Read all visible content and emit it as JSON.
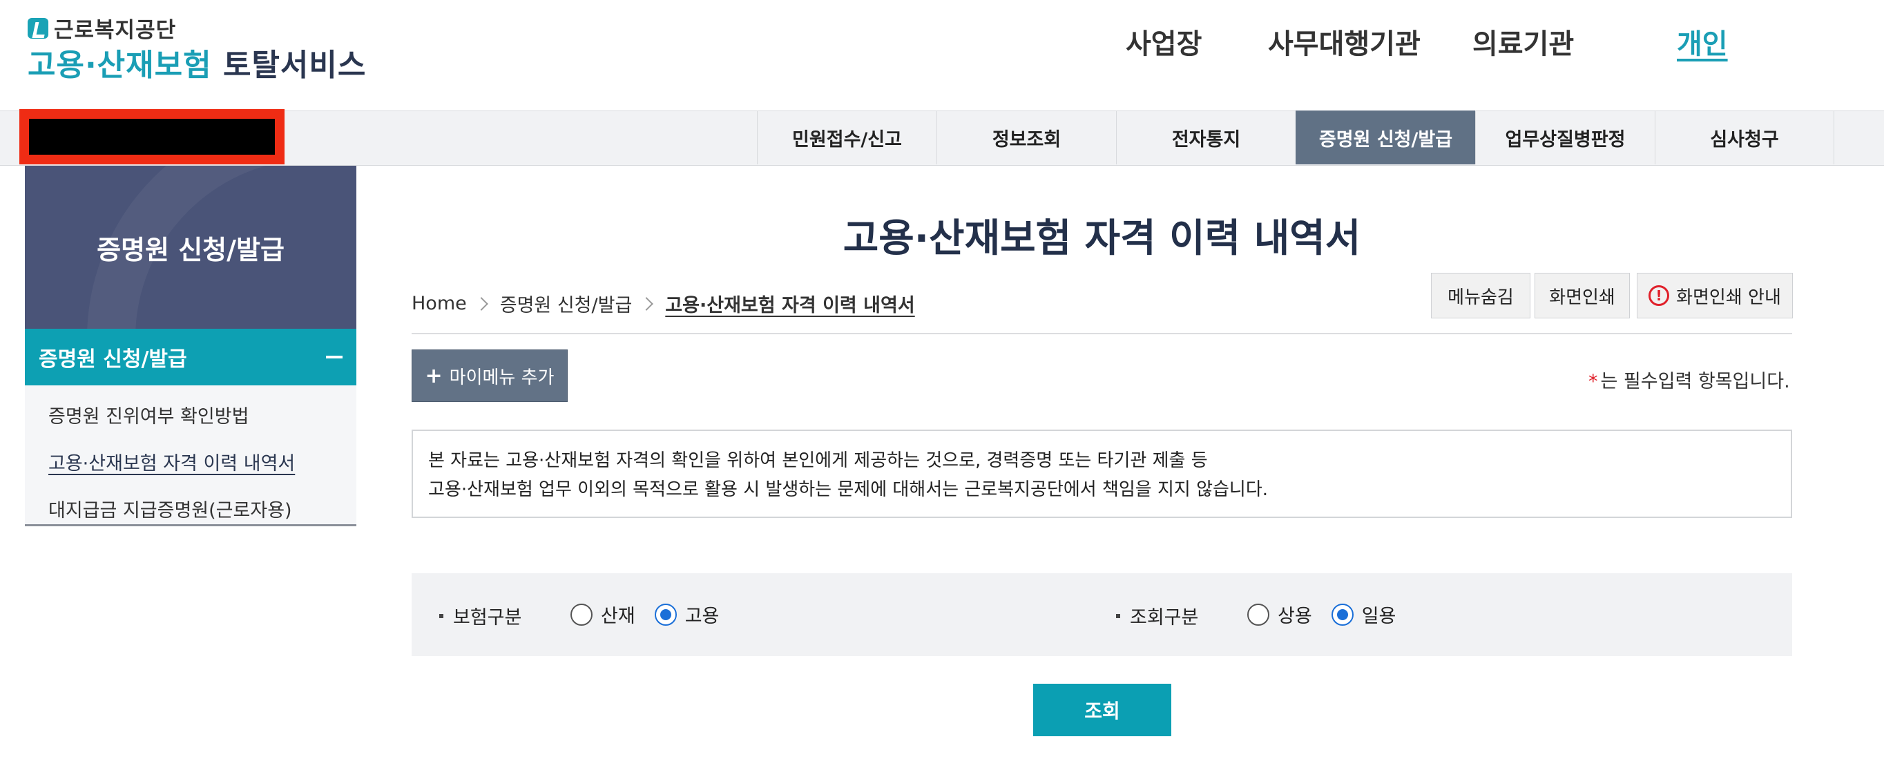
{
  "header": {
    "org_name": "근로복지공단",
    "service_name_teal": "고용·산재보험",
    "service_name_dark": "토탈서비스",
    "top_nav": [
      {
        "label": "사업장",
        "active": false
      },
      {
        "label": "사무대행기관",
        "active": false
      },
      {
        "label": "의료기관",
        "active": false
      },
      {
        "label": "개인",
        "active": true
      }
    ]
  },
  "gnb": {
    "items": [
      {
        "label": "민원접수/신고",
        "selected": false
      },
      {
        "label": "정보조회",
        "selected": false
      },
      {
        "label": "전자통지",
        "selected": false
      },
      {
        "label": "증명원 신청/발급",
        "selected": true
      },
      {
        "label": "업무상질병판정",
        "selected": false
      },
      {
        "label": "심사청구",
        "selected": false
      }
    ]
  },
  "sidebar": {
    "title": "증명원 신청/발급",
    "section": "증명원 신청/발급",
    "items": [
      {
        "label": "증명원 진위여부 확인방법",
        "current": false
      },
      {
        "label": "고용·산재보험 자격 이력 내역서",
        "current": true
      },
      {
        "label": "대지급금 지급증명원(근로자용)",
        "current": false
      }
    ]
  },
  "main": {
    "title": "고용·산재보험 자격 이력 내역서",
    "breadcrumb": [
      "Home",
      "증명원 신청/발급",
      "고용·산재보험 자격 이력 내역서"
    ],
    "buttons": {
      "hide_menu": "메뉴숨김",
      "print": "화면인쇄",
      "print_guide": "화면인쇄 안내"
    },
    "add_mymenu": "마이메뉴 추가",
    "required_note_star": "*",
    "required_note": "는 필수입력 항목입니다.",
    "notice_lines": [
      "본 자료는 고용·산재보험 자격의 확인을 위하여 본인에게 제공하는 것으로, 경력증명 또는 타기관 제출 등",
      "고용·산재보험 업무 이외의 목적으로 활용 시 발생하는 문제에 대해서는 근로복지공단에서 책임을 지지 않습니다."
    ],
    "search": {
      "insurance_label": "보험구분",
      "insurance_options": [
        {
          "label": "산재",
          "checked": false
        },
        {
          "label": "고용",
          "checked": true
        }
      ],
      "query_label": "조회구분",
      "query_options": [
        {
          "label": "상용",
          "checked": false
        },
        {
          "label": "일용",
          "checked": true
        }
      ],
      "submit_label": "조회"
    }
  },
  "colors": {
    "brand_teal": "#1a9eb5",
    "brand_navy": "#2a3650",
    "gnb_selected": "#607185",
    "sidebar_head": "#4a5478"
  }
}
